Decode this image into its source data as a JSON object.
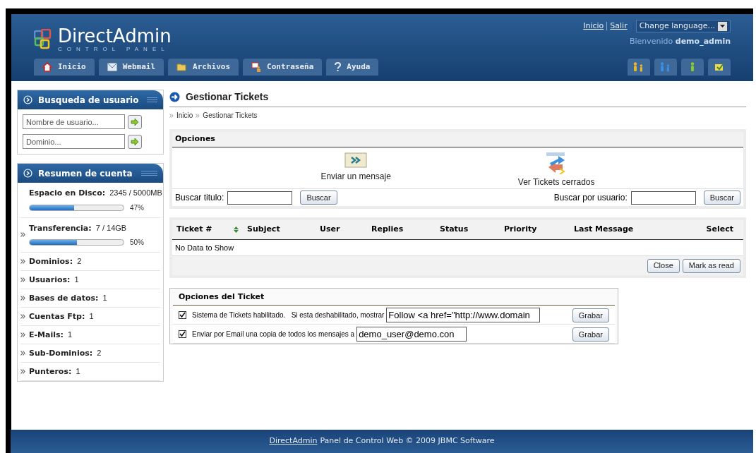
{
  "header": {
    "logo": {
      "title": "DirectAdmin",
      "subtitle": "CONTROL PANEL"
    },
    "top_links": [
      "Inicio",
      "Salir"
    ],
    "language_select": "Change language...",
    "welcome": {
      "label": "Bienvenido",
      "user": "demo_admin"
    },
    "tabs": [
      {
        "label": "Inicio",
        "selected": false
      },
      {
        "label": "Webmail",
        "selected": false
      },
      {
        "label": "Archivos",
        "selected": false
      },
      {
        "label": "Contraseña",
        "selected": false
      },
      {
        "label": "Ayuda",
        "selected": false
      }
    ]
  },
  "sidebar": {
    "user_search": {
      "title": "Busqueda de usuario",
      "fields": [
        {
          "placeholder": "Nombre de usuario..."
        },
        {
          "placeholder": "Dominio..."
        }
      ]
    },
    "account_summary": {
      "title": "Resumen de cuenta",
      "items": [
        {
          "kind": "meter",
          "label": "Espacio en Disco:",
          "value": "2345 / 5000MB",
          "level": 0.47,
          "reading": "47%"
        },
        {
          "kind": "meter",
          "label": "Transferencia:",
          "value": "7 / 14GB",
          "level": 0.5,
          "reading": "50%"
        },
        {
          "kind": "stat",
          "label": "Dominios:",
          "value": "2"
        },
        {
          "kind": "stat",
          "label": "Usuarios:",
          "value": "1"
        },
        {
          "kind": "stat",
          "label": "Bases de datos:",
          "value": "1"
        },
        {
          "kind": "stat",
          "label": "Cuentas Ftp:",
          "value": "1"
        },
        {
          "kind": "stat",
          "label": "E-Mails:",
          "value": "1"
        },
        {
          "kind": "stat",
          "label": "Sub-Dominios:",
          "value": "2"
        },
        {
          "kind": "stat",
          "label": "Punteros:",
          "value": "1"
        }
      ]
    }
  },
  "main": {
    "title": "Gestionar Tickets",
    "breadcrumb": [
      "Inicio",
      "Gestionar Tickets"
    ],
    "options": {
      "title": "Opciones",
      "actions": [
        {
          "label": "Enviar un mensaje"
        },
        {
          "label": "Ver Tickets cerrados"
        }
      ],
      "search_title": {
        "label": "Buscar titulo:",
        "button": "Buscar"
      },
      "search_user": {
        "label": "Buscar por usuario:",
        "button": "Buscar"
      }
    },
    "table": {
      "columns": [
        {
          "label": "Ticket #",
          "sortable": true
        },
        {
          "label": "Subject",
          "sortable": false
        },
        {
          "label": "User",
          "sortable": false
        },
        {
          "label": "Replies",
          "sortable": false
        },
        {
          "label": "Status",
          "sortable": false
        },
        {
          "label": "Priority",
          "sortable": false
        },
        {
          "label": "Last Message",
          "sortable": false
        },
        {
          "label": "Select",
          "sortable": false
        }
      ],
      "empty": "No Data to Show",
      "buttons": [
        "Close",
        "Mark as read"
      ]
    },
    "ticket_options": {
      "title": "Opciones del Ticket",
      "rows": [
        {
          "checked": true,
          "label": "Sistema de Tickets habilitado.   Si esta deshabilitado, mostrar",
          "value": "Follow <a href=\"http://www.domain",
          "button": "Grabar"
        },
        {
          "checked": true,
          "label": "Enviar por Email una copia de todos los mensajes a",
          "value": "demo_user@demo.con",
          "button": "Grabar"
        }
      ]
    }
  },
  "footer": {
    "link": "DirectAdmin",
    "text": "Panel de Control Web © 2009 JBMC Software"
  }
}
